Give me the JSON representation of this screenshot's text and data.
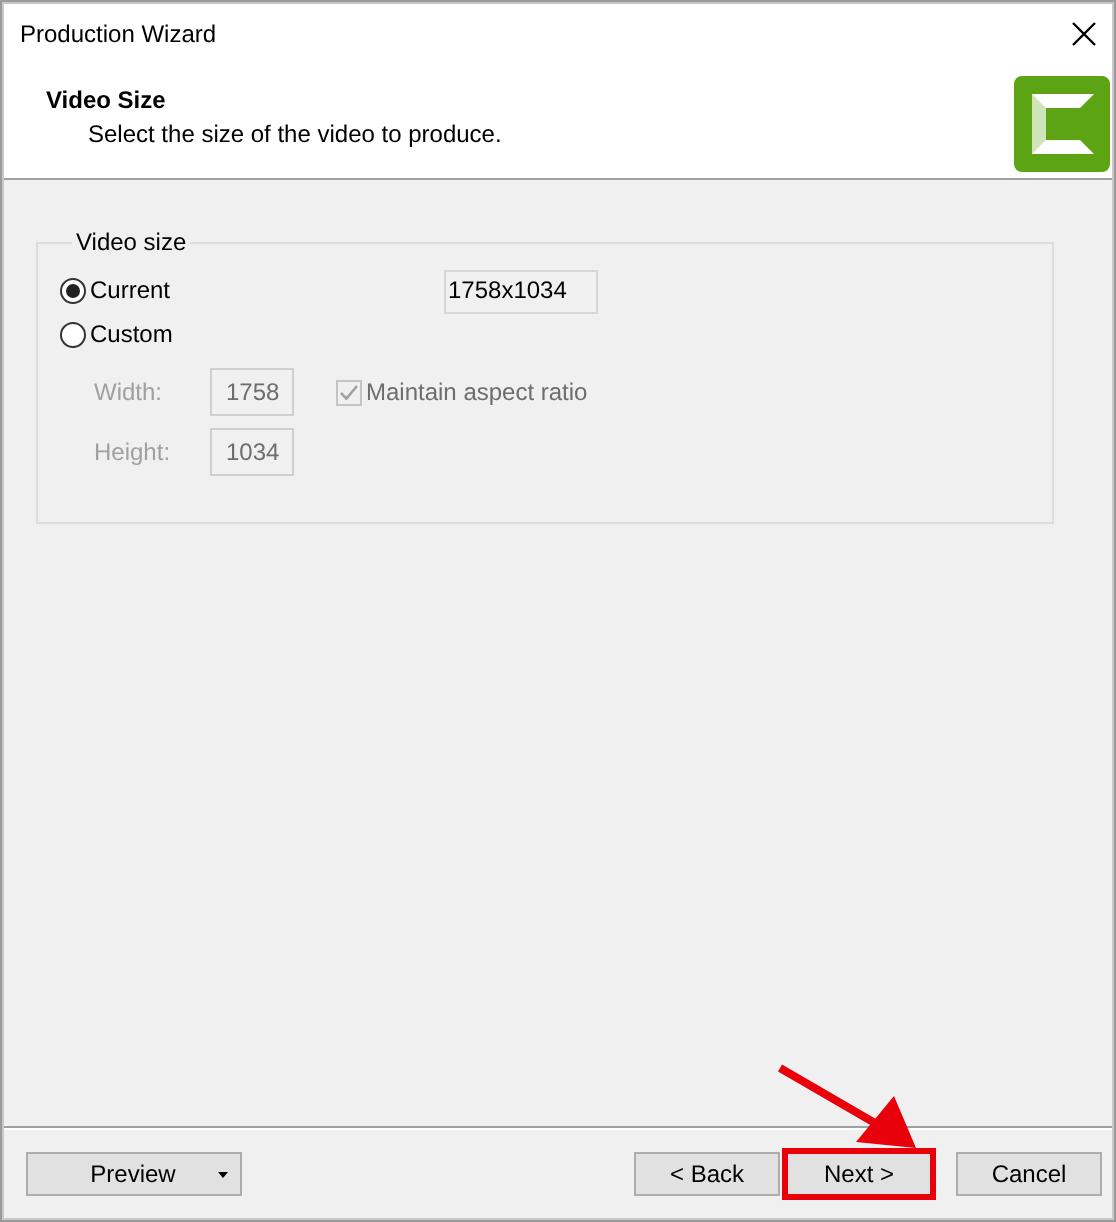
{
  "window": {
    "title": "Production Wizard"
  },
  "header": {
    "title": "Video Size",
    "subtitle": "Select the size of the video to produce."
  },
  "group": {
    "title": "Video size",
    "options": [
      {
        "label": "Current",
        "selected": true
      },
      {
        "label": "Custom",
        "selected": false
      }
    ],
    "current_size": "1758x1034",
    "fields": [
      {
        "label": "Width:",
        "value": "1758",
        "disabled": true
      },
      {
        "label": "Height:",
        "value": "1034",
        "disabled": true
      }
    ],
    "maintain_aspect": {
      "label": "Maintain aspect ratio",
      "checked": true,
      "disabled": true
    }
  },
  "buttons": [
    {
      "label": "Preview",
      "kind": "dropdown",
      "highlighted": false
    },
    {
      "label": "< Back",
      "kind": "plain",
      "highlighted": false
    },
    {
      "label": "Next >",
      "kind": "plain",
      "highlighted": true
    },
    {
      "label": "Cancel",
      "kind": "plain",
      "highlighted": false
    }
  ]
}
